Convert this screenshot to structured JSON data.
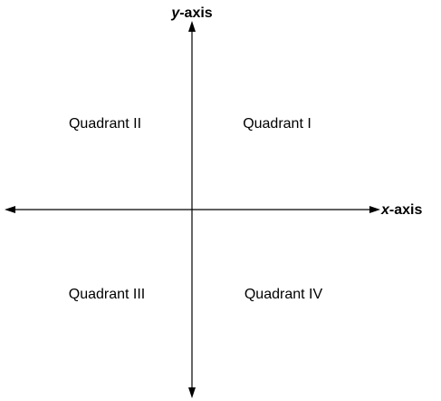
{
  "axes": {
    "y_label_var": "y",
    "y_label_suffix": "-axis",
    "x_label_var": "x",
    "x_label_suffix": "-axis"
  },
  "quadrants": {
    "q1": "Quadrant I",
    "q2": "Quadrant II",
    "q3": "Quadrant III",
    "q4": "Quadrant IV"
  },
  "colors": {
    "stroke": "#000000",
    "background": "#ffffff"
  }
}
